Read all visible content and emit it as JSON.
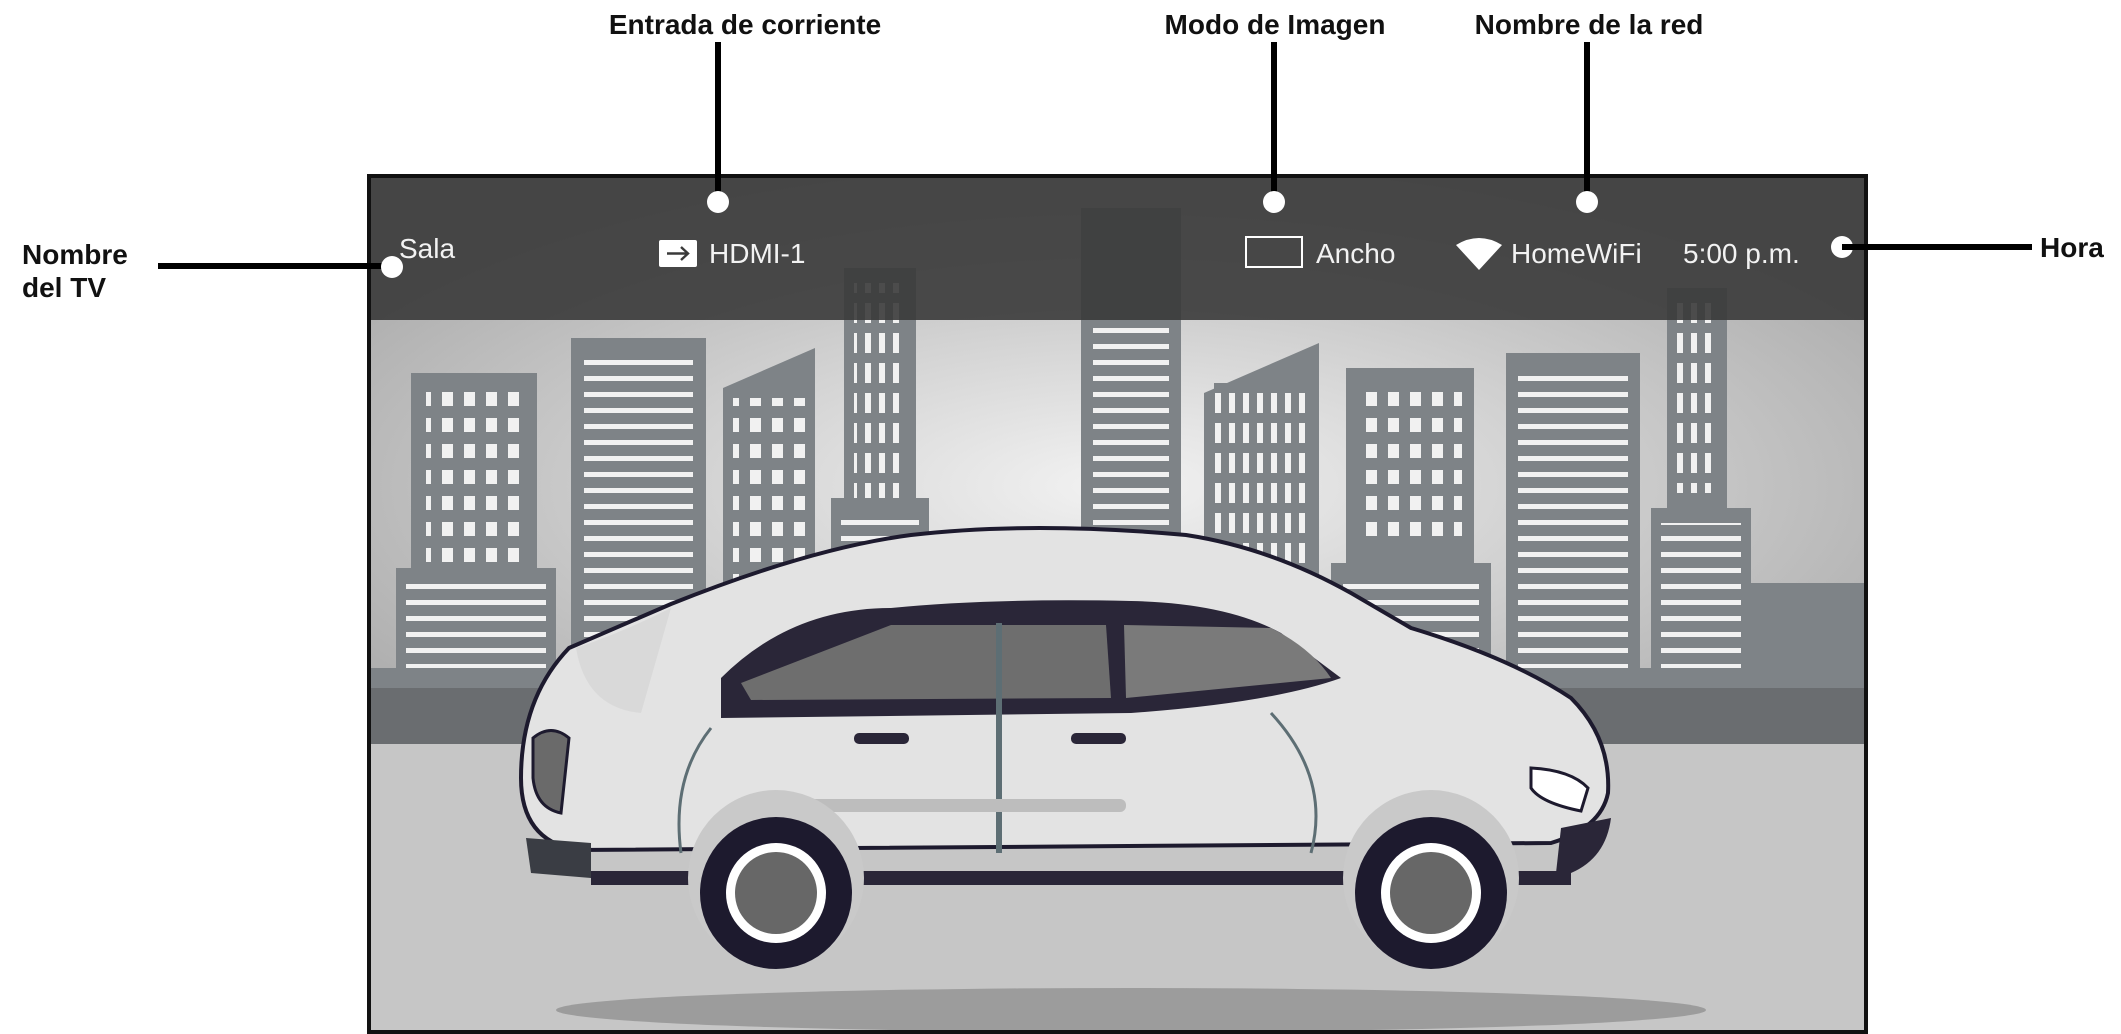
{
  "callouts": {
    "tv_name": "Nombre\ndel TV",
    "power_input": "Entrada de corriente",
    "picture_mode": "Modo de Imagen",
    "network_name": "Nombre de la red",
    "time": "Hora"
  },
  "tv_overlay": {
    "tv_name": "Sala",
    "input": "HDMI-1",
    "picture_mode": "Ancho",
    "network": "HomeWiFi",
    "time": "5:00 p.m."
  },
  "icons": {
    "input": "input-arrow-icon",
    "picture_mode": "aspect-ratio-icon",
    "network": "wifi-icon"
  },
  "colors": {
    "callout_line": "#000000",
    "overlay_bg": "#3a3a3a",
    "overlay_text": "#f2f2f2",
    "indicator_dot": "#ffffff"
  }
}
